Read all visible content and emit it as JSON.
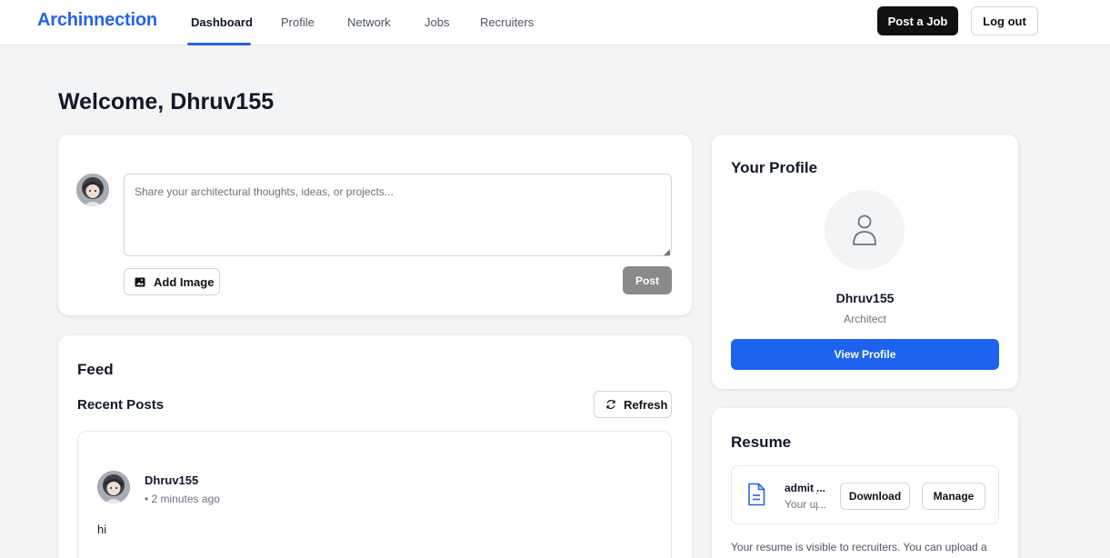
{
  "app": {
    "brand": "Archinnection",
    "nav": [
      "Dashboard",
      "Profile",
      "Network",
      "Jobs",
      "Recruiters"
    ],
    "active_nav": "Dashboard",
    "post_job_label": "Post a Job",
    "logout_label": "Log out",
    "accent_color": "#2563eb"
  },
  "welcome": "Welcome, Dhruv155",
  "composer": {
    "placeholder": "Share your architectural thoughts, ideas, or projects...",
    "value": "",
    "add_image_label": "Add Image",
    "post_label": "Post"
  },
  "feed": {
    "title": "Feed",
    "recent_title": "Recent Posts",
    "refresh_label": "Refresh",
    "posts": [
      {
        "author": "Dhruv155",
        "time": "• 2 minutes ago",
        "body": "hi"
      }
    ]
  },
  "profile": {
    "title": "Your Profile",
    "name": "Dhruv155",
    "role": "Architect",
    "view_label": "View Profile"
  },
  "resume": {
    "title": "Resume",
    "file_name": "admit je",
    "file_sub": "Your upl",
    "download_label": "Download",
    "manage_label": "Manage",
    "note": "Your resume is visible to recruiters. You can upload a"
  }
}
